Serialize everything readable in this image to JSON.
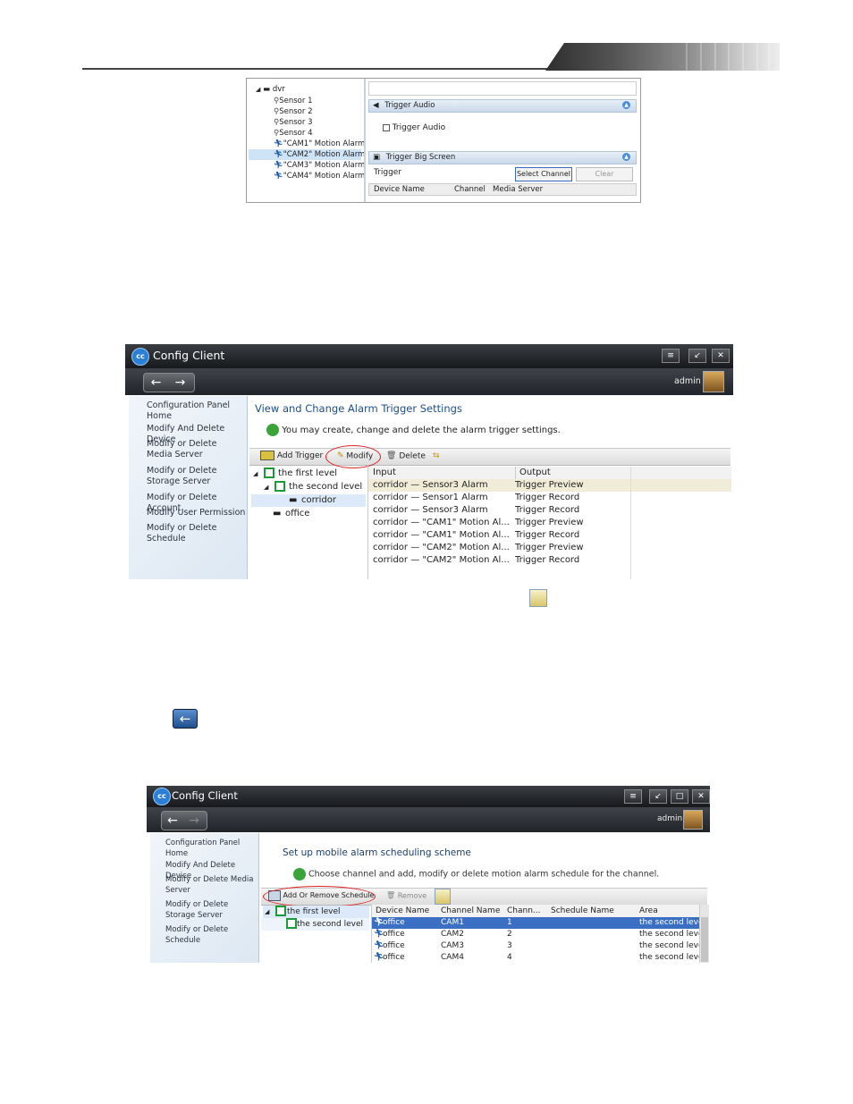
{
  "screenshot1": {
    "tree": {
      "root": "dvr",
      "items": [
        "Sensor 1",
        "Sensor 2",
        "Sensor 3",
        "Sensor 4",
        "\"CAM1\" Motion Alarm",
        "\"CAM2\" Motion Alarm",
        "\"CAM3\" Motion Alarm",
        "\"CAM4\" Motion Alarm"
      ],
      "selected_index": 5
    },
    "trigger_audio": {
      "header": "Trigger Audio",
      "checkbox_label": "Trigger Audio"
    },
    "trigger_big_screen": {
      "header": "Trigger Big Screen",
      "trigger_label": "Trigger",
      "select_channel": "Select Channel",
      "clear": "Clear",
      "columns": [
        "Device Name",
        "Channel",
        "Media Server"
      ]
    }
  },
  "screenshot2": {
    "app_title": "Config Client",
    "user": "admin",
    "sidebar": [
      "Configuration Panel Home",
      "Modify And Delete Device",
      "Modify or Delete Media Server",
      "Modify or Delete Storage Server",
      "Modify or Delete Account",
      "Modify User Permission",
      "Modify or Delete Schedule"
    ],
    "page_title": "View and Change Alarm Trigger Settings",
    "hint": "You may create, change and delete the alarm trigger settings.",
    "toolbar": {
      "add": "Add Trigger",
      "modify": "Modify",
      "delete": "Delete"
    },
    "tree": {
      "first": "the first level",
      "second": "the second level",
      "corridor": "corridor",
      "office": "office"
    },
    "columns": [
      "Input",
      "Output"
    ],
    "rows": [
      [
        "corridor — Sensor3 Alarm",
        "Trigger Preview"
      ],
      [
        "corridor — Sensor1 Alarm",
        "Trigger Record"
      ],
      [
        "corridor — Sensor3 Alarm",
        "Trigger Record"
      ],
      [
        "corridor — \"CAM1\" Motion Al...",
        "Trigger Preview"
      ],
      [
        "corridor — \"CAM1\" Motion Al...",
        "Trigger Record"
      ],
      [
        "corridor — \"CAM2\" Motion Al...",
        "Trigger Preview"
      ],
      [
        "corridor — \"CAM2\" Motion Al...",
        "Trigger Record"
      ]
    ]
  },
  "screenshot3": {
    "app_title": "Config Client",
    "user": "admin",
    "sidebar": [
      "Configuration Panel Home",
      "Modify And Delete Device",
      "Modify or Delete Media Server",
      "Modify or Delete Storage Server",
      "Modify or Delete Schedule"
    ],
    "page_title": "Set up mobile alarm scheduling scheme",
    "hint": "Choose channel and add, modify or delete motion alarm schedule for the channel.",
    "toolbar": {
      "add_remove": "Add Or Remove Schedule",
      "remove": "Remove"
    },
    "tree": {
      "first": "the first level",
      "second": "the second level"
    },
    "columns": [
      "Device Name",
      "Channel Name",
      "Chann...",
      "Schedule Name",
      "Area"
    ],
    "rows": [
      [
        "office",
        "CAM1",
        "1",
        "",
        "the second level"
      ],
      [
        "office",
        "CAM2",
        "2",
        "",
        "the second level"
      ],
      [
        "office",
        "CAM3",
        "3",
        "",
        "the second level"
      ],
      [
        "office",
        "CAM4",
        "4",
        "",
        "the second level"
      ]
    ]
  }
}
